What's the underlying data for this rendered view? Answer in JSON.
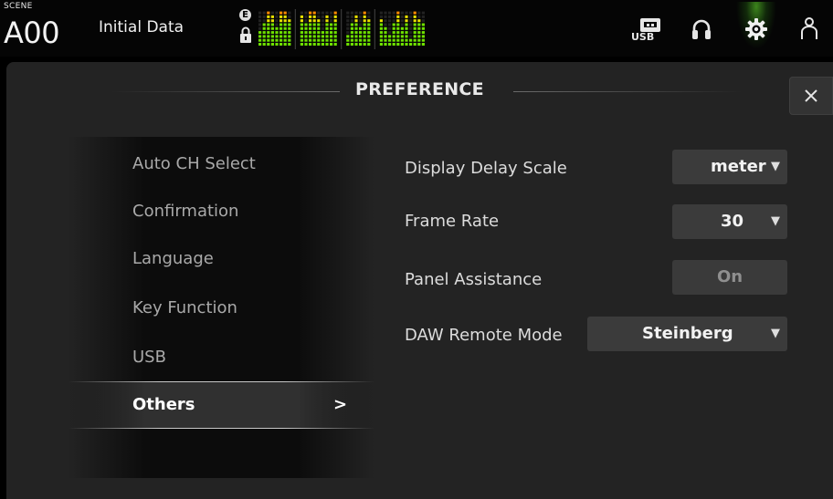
{
  "topbar": {
    "scene_caption": "SCENE",
    "scene_number": "A00",
    "scene_title": "Initial Data",
    "edit_badge": "E",
    "meter_colors": {
      "green": "#6ee000",
      "yellow": "#e8e000",
      "orange": "#ff8a00",
      "red": "#e02020"
    },
    "icons": [
      "usb-icon",
      "headphones-icon",
      "gear-icon",
      "user-icon"
    ],
    "usb_text": "USB"
  },
  "dialog": {
    "title": "PREFERENCE",
    "close_label": "×",
    "menu": {
      "items": [
        {
          "label": "Auto CH Select"
        },
        {
          "label": "Confirmation"
        },
        {
          "label": "Language"
        },
        {
          "label": "Key Function"
        },
        {
          "label": "USB"
        },
        {
          "label": "Others"
        }
      ],
      "selected_arrow": ">"
    },
    "settings": {
      "display_delay_scale": {
        "label": "Display Delay Scale",
        "value": "meter"
      },
      "frame_rate": {
        "label": "Frame Rate",
        "value": "30"
      },
      "panel_assistance": {
        "label": "Panel Assistance",
        "value": "On"
      },
      "daw_remote_mode": {
        "label": "DAW Remote Mode",
        "value": "Steinberg"
      },
      "caret": "▼"
    }
  }
}
